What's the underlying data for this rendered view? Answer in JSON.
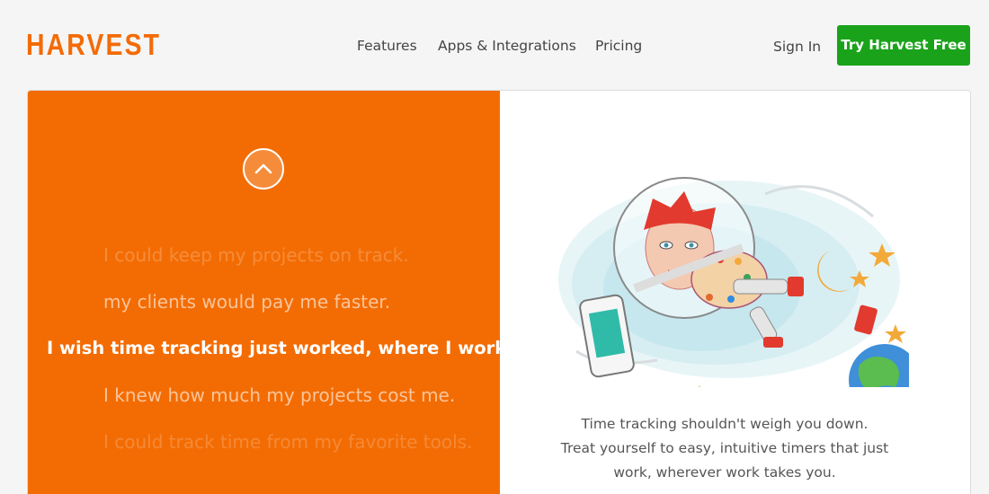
{
  "header": {
    "logo": "HARVEST",
    "nav": {
      "features": "Features",
      "apps": "Apps & Integrations",
      "pricing": "Pricing"
    },
    "sign_in": "Sign In",
    "cta": "Try Harvest Free"
  },
  "hero": {
    "lines": [
      "I could keep my projects on track.",
      "my clients would pay me faster.",
      "I wish time tracking just worked, where I work.",
      "I knew how much my projects cost me.",
      "I could track time from my favorite tools."
    ],
    "caption": [
      "Time tracking shouldn't weigh you down.",
      "Treat yourself to easy, intuitive timers that just",
      "work, wherever work takes you."
    ]
  },
  "colors": {
    "brand_orange": "#f36c03",
    "cta_green": "#1aa31a"
  },
  "icons": {
    "scroll_up": "chevron-up-icon"
  }
}
